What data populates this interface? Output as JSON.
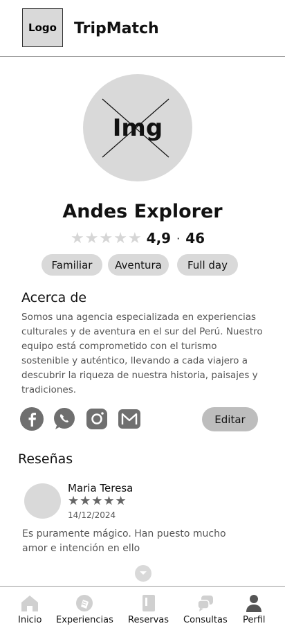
{
  "header": {
    "logo_label": "Logo",
    "app_title": "TripMatch"
  },
  "profile": {
    "image_label": "Img",
    "name": "Andes Explorer",
    "stars": [
      "★",
      "★",
      "★",
      "★",
      "★"
    ],
    "rating": "4,9",
    "separator": "·",
    "review_count": "46",
    "tags": [
      "Familiar",
      "Aventura",
      "Full day"
    ]
  },
  "about": {
    "title": "Acerca de",
    "text": "Somos una agencia especializada en experiencias culturales y de aventura en el sur del Perú. Nuestro equipo está comprometido con el turismo sostenible y auténtico, llevando a cada viajero a descubrir la riqueza de nuestra historia, paisajes y tradiciones."
  },
  "socials": [
    {
      "icon": "facebook-icon"
    },
    {
      "icon": "whatsapp-icon"
    },
    {
      "icon": "instagram-icon"
    },
    {
      "icon": "mail-icon"
    }
  ],
  "edit_label": "Editar",
  "reviews": {
    "title": "Reseñas",
    "items": [
      {
        "name": "Maria Teresa",
        "stars": "★★★★★",
        "date": "14/12/2024",
        "text": "Es puramente mágico. Han puesto mucho amor e intención en ello"
      }
    ]
  },
  "nav": {
    "items": [
      {
        "label": "Inicio",
        "icon": "home-icon"
      },
      {
        "label": "Experiencias",
        "icon": "experiences-icon"
      },
      {
        "label": "Reservas",
        "icon": "book-icon"
      },
      {
        "label": "Consultas",
        "icon": "chat-icon"
      },
      {
        "label": "Perfil",
        "icon": "user-icon"
      }
    ]
  },
  "colors": {
    "placeholder": "#d9d9d9",
    "icon": "#6f6f6f",
    "button": "#bdbdbd"
  }
}
